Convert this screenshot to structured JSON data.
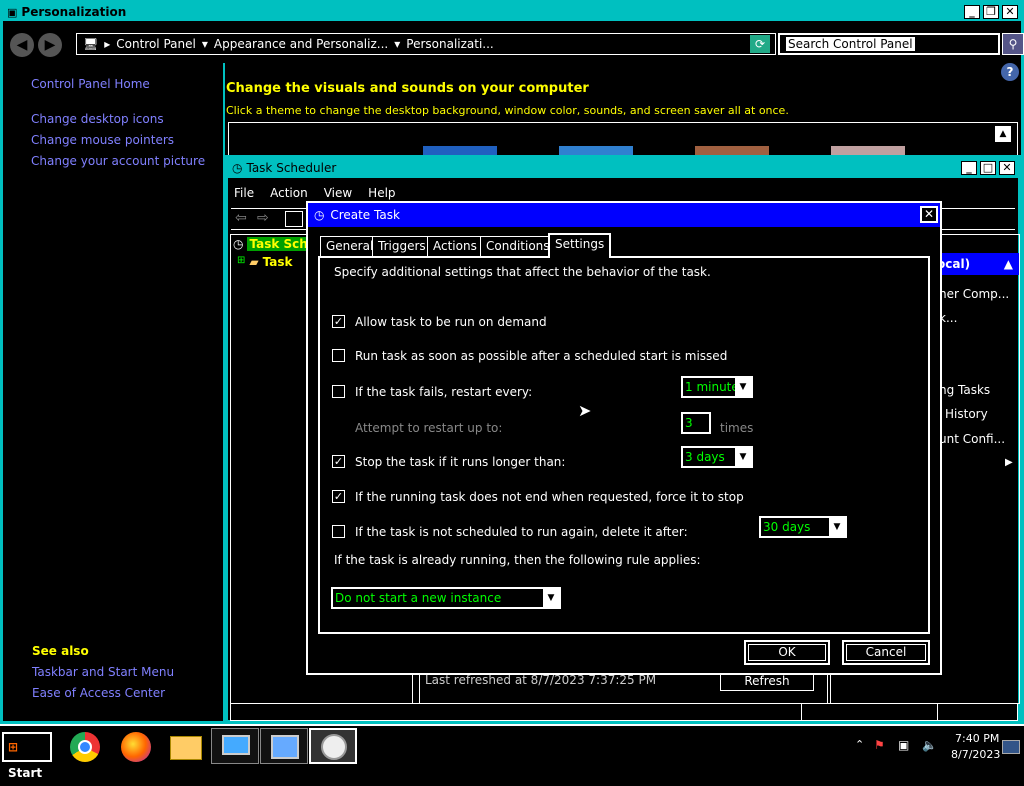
{
  "personalization": {
    "title": "Personalization",
    "breadcrumb": [
      "Control Panel",
      "Appearance and Personaliz...",
      "Personalizati..."
    ],
    "search_placeholder": "Search Control Panel",
    "sidebar": {
      "home": "Control Panel Home",
      "links": [
        "Change desktop icons",
        "Change mouse pointers",
        "Change your account picture"
      ],
      "see_also_title": "See also",
      "see_also": [
        "Taskbar and Start Menu",
        "Ease of Access Center"
      ]
    },
    "heading": "Change the visuals and sounds on your computer",
    "subheading": "Click a theme to change the desktop background, window color, sounds, and screen saver all at once."
  },
  "task_scheduler": {
    "title": "Task Scheduler",
    "menu": [
      "File",
      "Action",
      "View",
      "Help"
    ],
    "tree": [
      "Task Sch",
      "Task"
    ],
    "actions_header": "ocal)",
    "actions": [
      "ner Comp...",
      "k...",
      "ng Tasks",
      "History",
      "unt Confi..."
    ],
    "last_refreshed": "Last refreshed at 8/7/2023 7:37:25 PM",
    "refresh": "Refresh"
  },
  "create_task": {
    "title": "Create Task",
    "tabs": [
      "General",
      "Triggers",
      "Actions",
      "Conditions",
      "Settings"
    ],
    "active_tab": "Settings",
    "intro": "Specify additional settings that affect the behavior of the task.",
    "options": {
      "allow_on_demand": {
        "label": "Allow task to be run on demand",
        "checked": true
      },
      "run_asap": {
        "label": "Run task as soon as possible after a scheduled start is missed",
        "checked": false
      },
      "restart": {
        "label": "If the task fails, restart every:",
        "checked": false,
        "value": "1 minute"
      },
      "attempt_label": "Attempt to restart up to:",
      "attempt_value": "3",
      "times": "times",
      "stop_longer": {
        "label": "Stop the task if it runs longer than:",
        "checked": true,
        "value": "3 days"
      },
      "force_stop": {
        "label": "If the running task does not end when requested, force it to stop",
        "checked": true
      },
      "delete_after": {
        "label": "If the task is not scheduled to run again, delete it after:",
        "checked": false,
        "value": "30 days"
      },
      "rule_label": "If the task is already running, then the following rule applies:",
      "rule_value": "Do not start a new instance"
    },
    "ok": "OK",
    "cancel": "Cancel"
  },
  "taskbar": {
    "start": "Start",
    "time": "7:40 PM",
    "date": "8/7/2023"
  }
}
